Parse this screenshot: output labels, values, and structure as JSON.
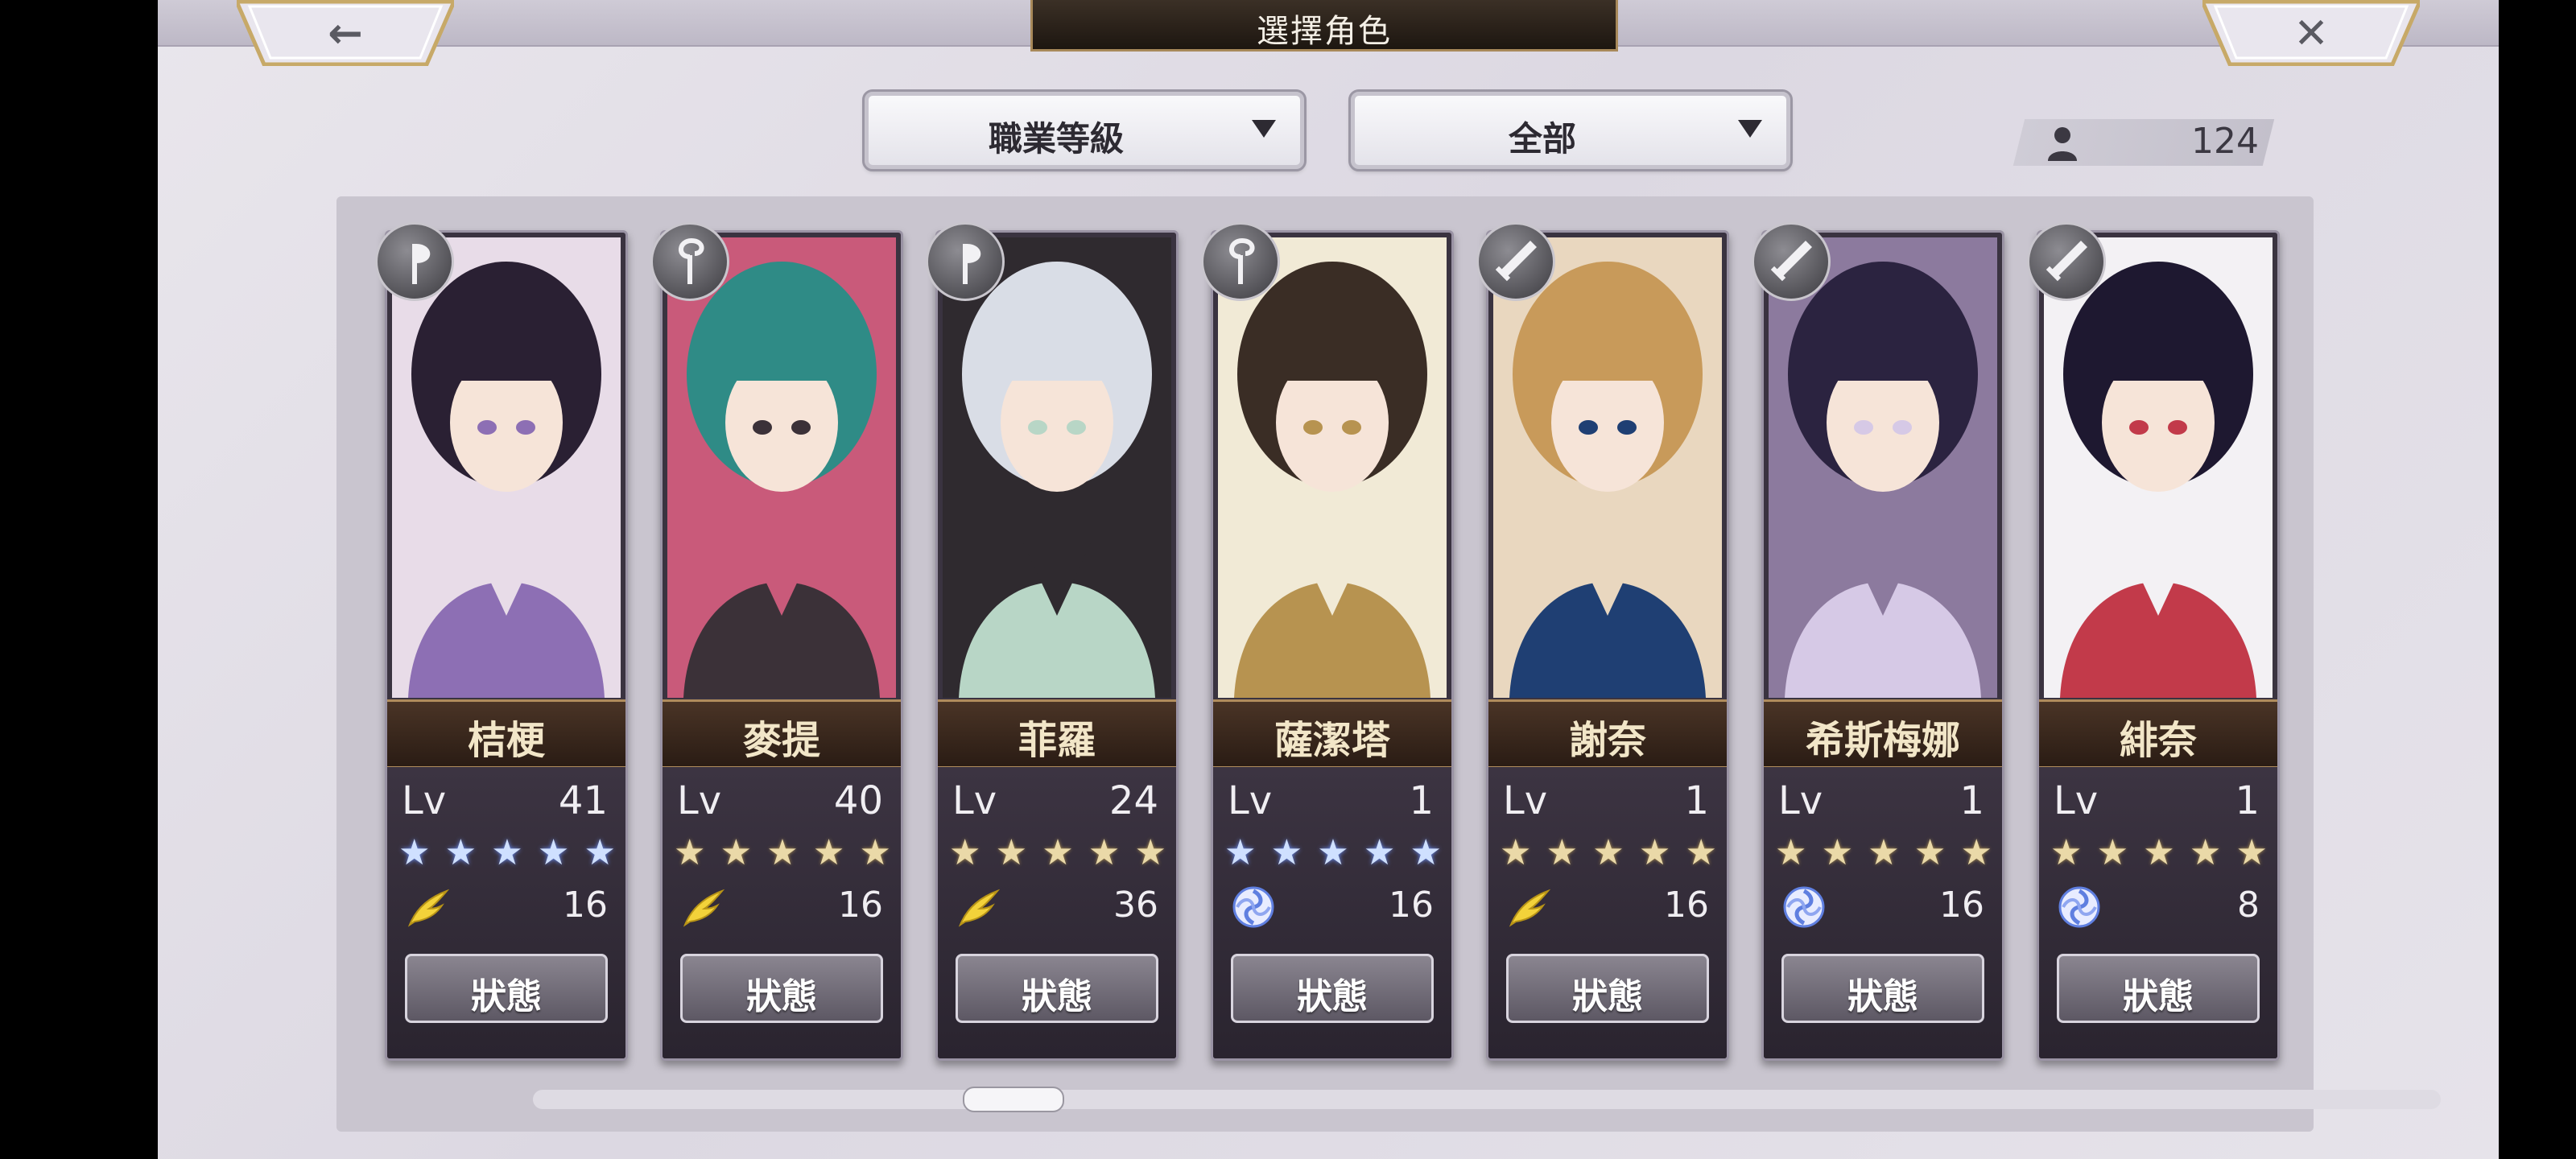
{
  "header": {
    "title": "選擇角色",
    "back_icon": "back-arrow-icon",
    "close_icon": "close-x-icon",
    "back_glyph": "←",
    "close_glyph": "✕"
  },
  "filters": {
    "sort_label": "職業等級",
    "filter_label": "全部"
  },
  "roster_count": {
    "icon": "person-icon",
    "value": "124"
  },
  "characters": [
    {
      "name": "桔梗",
      "level_label": "Lv",
      "level": "41",
      "star_color": "blue",
      "element": "wind-feather",
      "skill": "16",
      "status_label": "狀態",
      "weapon": "axe",
      "palette": [
        "#2a2033",
        "#e8dce8",
        "#8d6fb4"
      ]
    },
    {
      "name": "麥提",
      "level_label": "Lv",
      "level": "40",
      "star_color": "gold",
      "element": "wind-feather",
      "skill": "16",
      "status_label": "狀態",
      "weapon": "staff",
      "palette": [
        "#2f8b86",
        "#c95a7a",
        "#3b3138"
      ]
    },
    {
      "name": "菲羅",
      "level_label": "Lv",
      "level": "24",
      "star_color": "gold",
      "element": "wind-feather",
      "skill": "36",
      "status_label": "狀態",
      "weapon": "axe",
      "palette": [
        "#d9dde6",
        "#2f2a2f",
        "#b8d6c6"
      ]
    },
    {
      "name": "薩潔塔",
      "level_label": "Lv",
      "level": "1",
      "star_color": "blue",
      "element": "water-swirl",
      "skill": "16",
      "status_label": "狀態",
      "weapon": "staff",
      "palette": [
        "#3a2d25",
        "#f1ead6",
        "#b79350"
      ]
    },
    {
      "name": "謝奈",
      "level_label": "Lv",
      "level": "1",
      "star_color": "gold",
      "element": "wind-feather",
      "skill": "16",
      "status_label": "狀態",
      "weapon": "sword",
      "palette": [
        "#c89a5a",
        "#e9d7bf",
        "#1f3f73"
      ]
    },
    {
      "name": "希斯梅娜",
      "level_label": "Lv",
      "level": "1",
      "star_color": "gold",
      "element": "water-swirl",
      "skill": "16",
      "status_label": "狀態",
      "weapon": "sword",
      "palette": [
        "#2b2340",
        "#8c7a9e",
        "#d6c9e6"
      ]
    },
    {
      "name": "緋奈",
      "level_label": "Lv",
      "level": "1",
      "star_color": "gold",
      "element": "water-swirl",
      "skill": "8",
      "status_label": "狀態",
      "weapon": "sword",
      "palette": [
        "#1e1830",
        "#f3f1f4",
        "#c23a4a"
      ]
    }
  ],
  "colors": {
    "title_plate": "#1d1610",
    "name_bar": "#3a271c",
    "star_blue": "#cfe0ff",
    "star_gold": "#ead9a8",
    "wind_icon": "#f3d23a",
    "water_icon": "#5f7fe0"
  }
}
